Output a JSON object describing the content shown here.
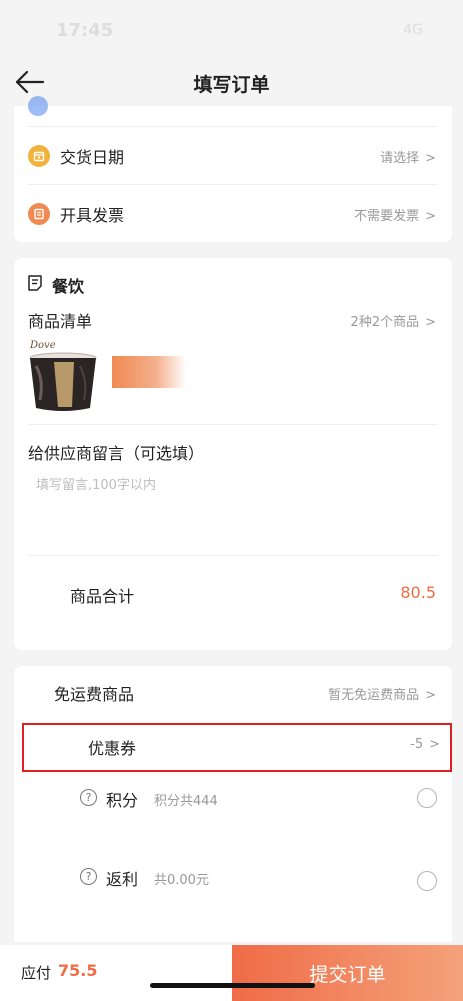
{
  "status": {
    "time": "17:45",
    "right": "4G"
  },
  "nav": {
    "title": "填写订单"
  },
  "delivery": {
    "date_label": "交货日期",
    "date_value": "请选择",
    "invoice_label": "开具发票",
    "invoice_value": "不需要发票"
  },
  "order": {
    "section_title": "餐饮",
    "items_label": "商品清单",
    "items_summary": "2种2个商品",
    "product_brand": "Dove",
    "message_label": "给供应商留言（可选填）",
    "message_placeholder": "填写留言,100字以内",
    "subtotal_label": "商品合计",
    "subtotal_value": "80.5"
  },
  "discounts": {
    "free_shipping_label": "免运费商品",
    "free_shipping_value": "暂无免运费商品",
    "coupon_label": "优惠券",
    "coupon_value": "-5",
    "points_label": "积分",
    "points_value": "积分共444",
    "rebate_label": "返利",
    "rebate_value": "共0.00元"
  },
  "footer": {
    "payable_label": "应付",
    "payable_value": "75.5",
    "submit_label": "提交订单"
  },
  "colors": {
    "accent": "#ef6c47",
    "highlight_border": "#e02020",
    "date_icon": "#f3b23a",
    "invoice_icon": "#f08a52"
  },
  "icons": [
    "back-arrow-icon",
    "calendar-icon",
    "invoice-icon",
    "receipt-icon",
    "chevron-right-icon",
    "help-icon"
  ]
}
